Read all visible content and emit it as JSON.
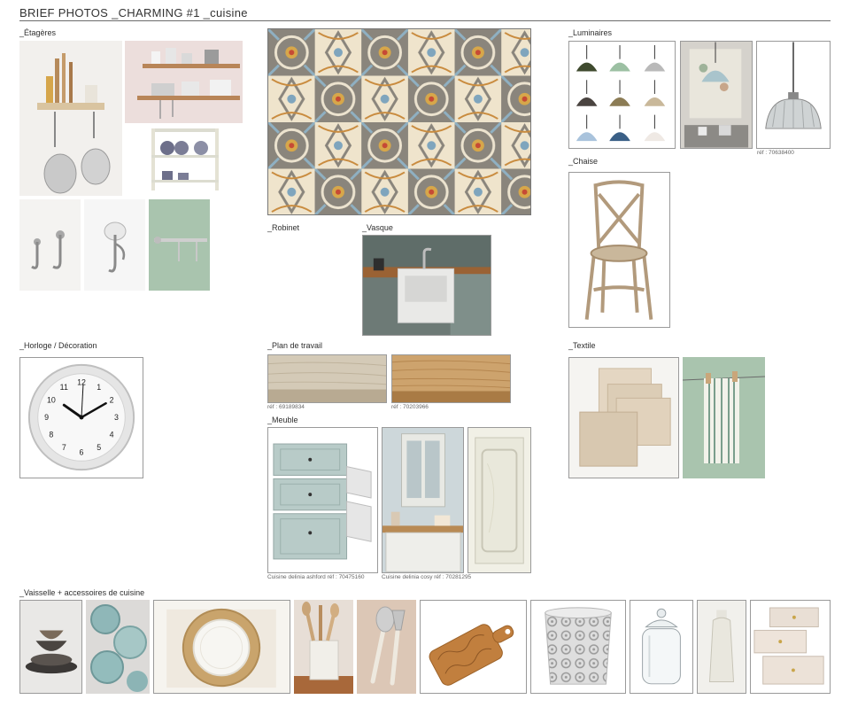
{
  "header": {
    "title": "BRIEF PHOTOS _CHARMING #1 _cuisine"
  },
  "sections": {
    "etageres": "_Étagères",
    "luminaires": "_Luminaires",
    "chaise": "_Chaise",
    "robinet": "_Robinet",
    "vasque": "_Vasque",
    "horloge": "_Horloge / Décoration",
    "plan": "_Plan de travail",
    "meuble": "_Meuble",
    "textile": "_Textile",
    "vaisselle": "_Vaisselle + accessoires de cuisine"
  },
  "refs": {
    "suspension": "réf : 70638400",
    "plan1": "réf : 69189834",
    "plan2": "réf : 70203966",
    "meuble1": "Cuisine delinia ashford réf : 70475160",
    "meuble2": "Cuisine delinia cosy réf : 70281295"
  },
  "clock": {
    "numbers": [
      "12",
      "1",
      "2",
      "3",
      "4",
      "5",
      "6",
      "7",
      "8",
      "9",
      "10",
      "11"
    ]
  },
  "colors": {
    "sage": "#a9c4ae",
    "tile_grey": "#8a857c",
    "wood": "#c7a77d",
    "cabinet_blue": "#b8cbc8"
  }
}
